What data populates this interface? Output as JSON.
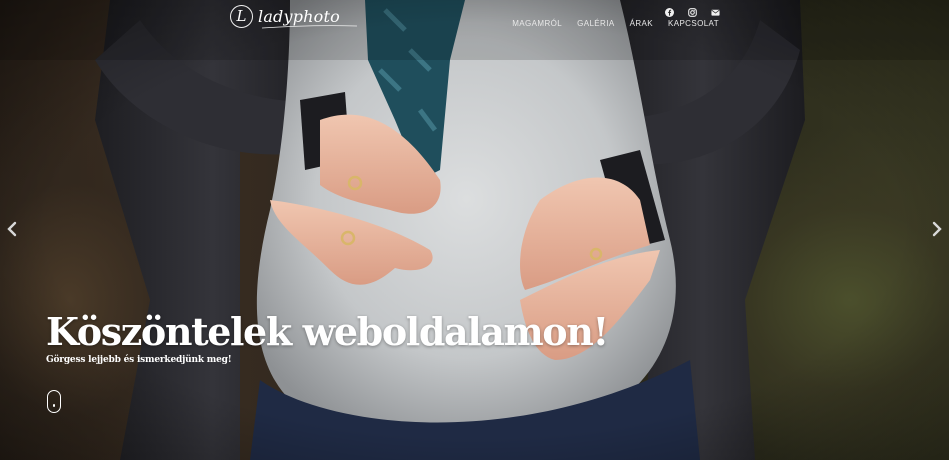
{
  "brand": {
    "name": "ladyphoto",
    "monogram": "L"
  },
  "social": [
    {
      "icon": "facebook-icon"
    },
    {
      "icon": "instagram-icon"
    },
    {
      "icon": "email-icon"
    }
  ],
  "nav": {
    "items": [
      {
        "label": "MAGAMRÓL"
      },
      {
        "label": "GALÉRIA"
      },
      {
        "label": "ÁRAK"
      },
      {
        "label": "KAPCSOLAT"
      }
    ]
  },
  "hero": {
    "title": "Köszöntelek weboldalamon!",
    "subtitle": "Görgess lejjebb és ismerkedjünk meg!",
    "image_subject": "pregnant belly with two pairs of hands wearing wedding rings",
    "prev_icon": "chevron-left-icon",
    "next_icon": "chevron-right-icon",
    "scroll_icon": "mouse-scroll-icon"
  },
  "colors": {
    "text": "#ffffff",
    "shirt": "#c9cbcc",
    "jacket": "#2b2b30",
    "scarf": "#1f4e5c",
    "skin": "#e8b8a0",
    "jeans": "#1f2a44"
  }
}
